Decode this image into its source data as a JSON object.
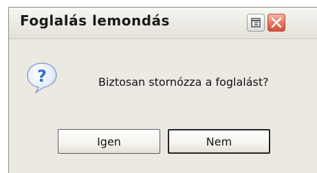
{
  "dialog": {
    "title": "Foglalás lemondás",
    "message": "Biztosan stornózza a foglalást?",
    "icon": "question-icon",
    "buttons": {
      "yes_label": "Igen",
      "no_label": "Nem"
    },
    "titlebar_controls": [
      "restore-icon",
      "close-icon"
    ]
  },
  "colors": {
    "dialog_background": "#ebe9e2",
    "close_button": "#e2755e",
    "question_icon": "#2f6fcf"
  }
}
